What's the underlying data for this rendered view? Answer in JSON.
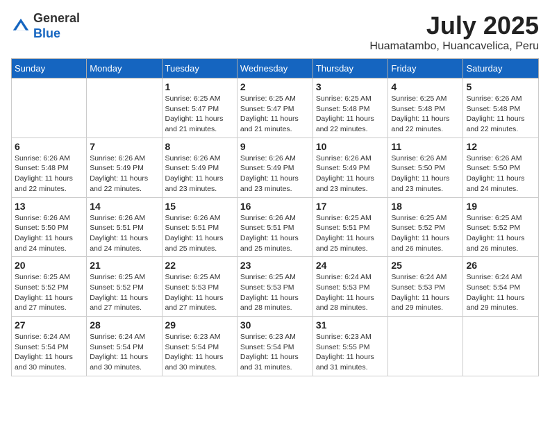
{
  "logo": {
    "general": "General",
    "blue": "Blue"
  },
  "title": "July 2025",
  "subtitle": "Huamatambo, Huancavelica, Peru",
  "days_of_week": [
    "Sunday",
    "Monday",
    "Tuesday",
    "Wednesday",
    "Thursday",
    "Friday",
    "Saturday"
  ],
  "weeks": [
    [
      {
        "day": "",
        "info": ""
      },
      {
        "day": "",
        "info": ""
      },
      {
        "day": "1",
        "info": "Sunrise: 6:25 AM\nSunset: 5:47 PM\nDaylight: 11 hours and 21 minutes."
      },
      {
        "day": "2",
        "info": "Sunrise: 6:25 AM\nSunset: 5:47 PM\nDaylight: 11 hours and 21 minutes."
      },
      {
        "day": "3",
        "info": "Sunrise: 6:25 AM\nSunset: 5:48 PM\nDaylight: 11 hours and 22 minutes."
      },
      {
        "day": "4",
        "info": "Sunrise: 6:25 AM\nSunset: 5:48 PM\nDaylight: 11 hours and 22 minutes."
      },
      {
        "day": "5",
        "info": "Sunrise: 6:26 AM\nSunset: 5:48 PM\nDaylight: 11 hours and 22 minutes."
      }
    ],
    [
      {
        "day": "6",
        "info": "Sunrise: 6:26 AM\nSunset: 5:48 PM\nDaylight: 11 hours and 22 minutes."
      },
      {
        "day": "7",
        "info": "Sunrise: 6:26 AM\nSunset: 5:49 PM\nDaylight: 11 hours and 22 minutes."
      },
      {
        "day": "8",
        "info": "Sunrise: 6:26 AM\nSunset: 5:49 PM\nDaylight: 11 hours and 23 minutes."
      },
      {
        "day": "9",
        "info": "Sunrise: 6:26 AM\nSunset: 5:49 PM\nDaylight: 11 hours and 23 minutes."
      },
      {
        "day": "10",
        "info": "Sunrise: 6:26 AM\nSunset: 5:49 PM\nDaylight: 11 hours and 23 minutes."
      },
      {
        "day": "11",
        "info": "Sunrise: 6:26 AM\nSunset: 5:50 PM\nDaylight: 11 hours and 23 minutes."
      },
      {
        "day": "12",
        "info": "Sunrise: 6:26 AM\nSunset: 5:50 PM\nDaylight: 11 hours and 24 minutes."
      }
    ],
    [
      {
        "day": "13",
        "info": "Sunrise: 6:26 AM\nSunset: 5:50 PM\nDaylight: 11 hours and 24 minutes."
      },
      {
        "day": "14",
        "info": "Sunrise: 6:26 AM\nSunset: 5:51 PM\nDaylight: 11 hours and 24 minutes."
      },
      {
        "day": "15",
        "info": "Sunrise: 6:26 AM\nSunset: 5:51 PM\nDaylight: 11 hours and 25 minutes."
      },
      {
        "day": "16",
        "info": "Sunrise: 6:26 AM\nSunset: 5:51 PM\nDaylight: 11 hours and 25 minutes."
      },
      {
        "day": "17",
        "info": "Sunrise: 6:25 AM\nSunset: 5:51 PM\nDaylight: 11 hours and 25 minutes."
      },
      {
        "day": "18",
        "info": "Sunrise: 6:25 AM\nSunset: 5:52 PM\nDaylight: 11 hours and 26 minutes."
      },
      {
        "day": "19",
        "info": "Sunrise: 6:25 AM\nSunset: 5:52 PM\nDaylight: 11 hours and 26 minutes."
      }
    ],
    [
      {
        "day": "20",
        "info": "Sunrise: 6:25 AM\nSunset: 5:52 PM\nDaylight: 11 hours and 27 minutes."
      },
      {
        "day": "21",
        "info": "Sunrise: 6:25 AM\nSunset: 5:52 PM\nDaylight: 11 hours and 27 minutes."
      },
      {
        "day": "22",
        "info": "Sunrise: 6:25 AM\nSunset: 5:53 PM\nDaylight: 11 hours and 27 minutes."
      },
      {
        "day": "23",
        "info": "Sunrise: 6:25 AM\nSunset: 5:53 PM\nDaylight: 11 hours and 28 minutes."
      },
      {
        "day": "24",
        "info": "Sunrise: 6:24 AM\nSunset: 5:53 PM\nDaylight: 11 hours and 28 minutes."
      },
      {
        "day": "25",
        "info": "Sunrise: 6:24 AM\nSunset: 5:53 PM\nDaylight: 11 hours and 29 minutes."
      },
      {
        "day": "26",
        "info": "Sunrise: 6:24 AM\nSunset: 5:54 PM\nDaylight: 11 hours and 29 minutes."
      }
    ],
    [
      {
        "day": "27",
        "info": "Sunrise: 6:24 AM\nSunset: 5:54 PM\nDaylight: 11 hours and 30 minutes."
      },
      {
        "day": "28",
        "info": "Sunrise: 6:24 AM\nSunset: 5:54 PM\nDaylight: 11 hours and 30 minutes."
      },
      {
        "day": "29",
        "info": "Sunrise: 6:23 AM\nSunset: 5:54 PM\nDaylight: 11 hours and 30 minutes."
      },
      {
        "day": "30",
        "info": "Sunrise: 6:23 AM\nSunset: 5:54 PM\nDaylight: 11 hours and 31 minutes."
      },
      {
        "day": "31",
        "info": "Sunrise: 6:23 AM\nSunset: 5:55 PM\nDaylight: 11 hours and 31 minutes."
      },
      {
        "day": "",
        "info": ""
      },
      {
        "day": "",
        "info": ""
      }
    ]
  ]
}
